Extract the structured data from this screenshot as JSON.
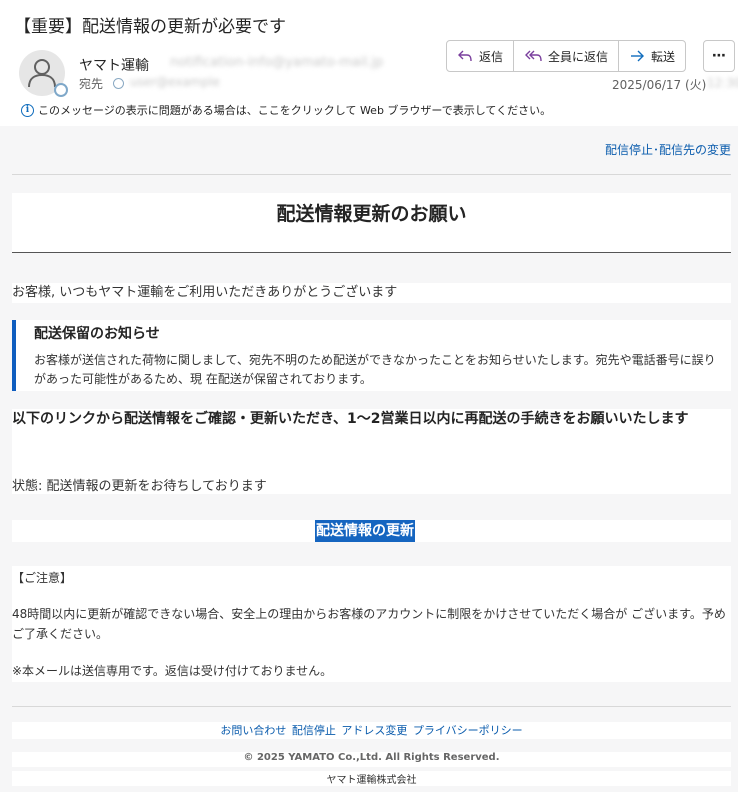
{
  "email": {
    "subject": "【重要】配送情報の更新が必要です",
    "sender_name": "ヤマト運輸",
    "sender_email_blurred": "notification-info@yamato-mail.jp",
    "to_label": "宛先",
    "to_value_blurred": "user@example",
    "date": "2025/06/17 (火)",
    "date_time_blurred": "12:30",
    "info_bar": "このメッセージの表示に問題がある場合は、ここをクリックして Web ブラウザーで表示してください。"
  },
  "actions": {
    "reply": "返信",
    "reply_all": "全員に返信",
    "forward": "転送",
    "more": "⋯"
  },
  "message": {
    "unsubscribe": "配信停止･配信先の変更",
    "title": "配送情報更新のお願い",
    "greeting": "お客様, いつもヤマト運輸をご利用いただきありがとうございます",
    "notice_title": "配送保留のお知らせ",
    "notice_text": "お客様が送信された荷物に関しまして、宛先不明のため配送ができなかったことをお知らせいたします。宛先や電話番号に誤りがあった可能性があるため、現 在配送が保留されております。",
    "link_intro": "以下のリンクから配送情報をご確認・更新いただき、1～2営業日以内に再配送の手続きをお願いいたします",
    "status": "状態: 配送情報の更新をお待ちしております",
    "update_link": "配送情報の更新",
    "caution_head": "【ご注意】",
    "caution_p1": "48時間以内に更新が確認できない場合、安全上の理由からお客様のアカウントに制限をかけさせていただく場合が ございます。予めご了承ください。",
    "caution_p2": "※本メールは送信専用です。返信は受け付けておりません。"
  },
  "footer": {
    "links": [
      "お問い合わせ",
      "配信停止",
      "アドレス変更",
      "プライバシーポリシー"
    ],
    "copyright": "© 2025 YAMATO Co.,Ltd. All Rights Reserved.",
    "company": "ヤマト運輸株式会社"
  },
  "colors": {
    "accent": "#0f6cbd",
    "link": "#0b5cad",
    "highlight": "#1565c0",
    "notice_border": "#0f5dbf",
    "body_bg": "#f6f6f7"
  }
}
